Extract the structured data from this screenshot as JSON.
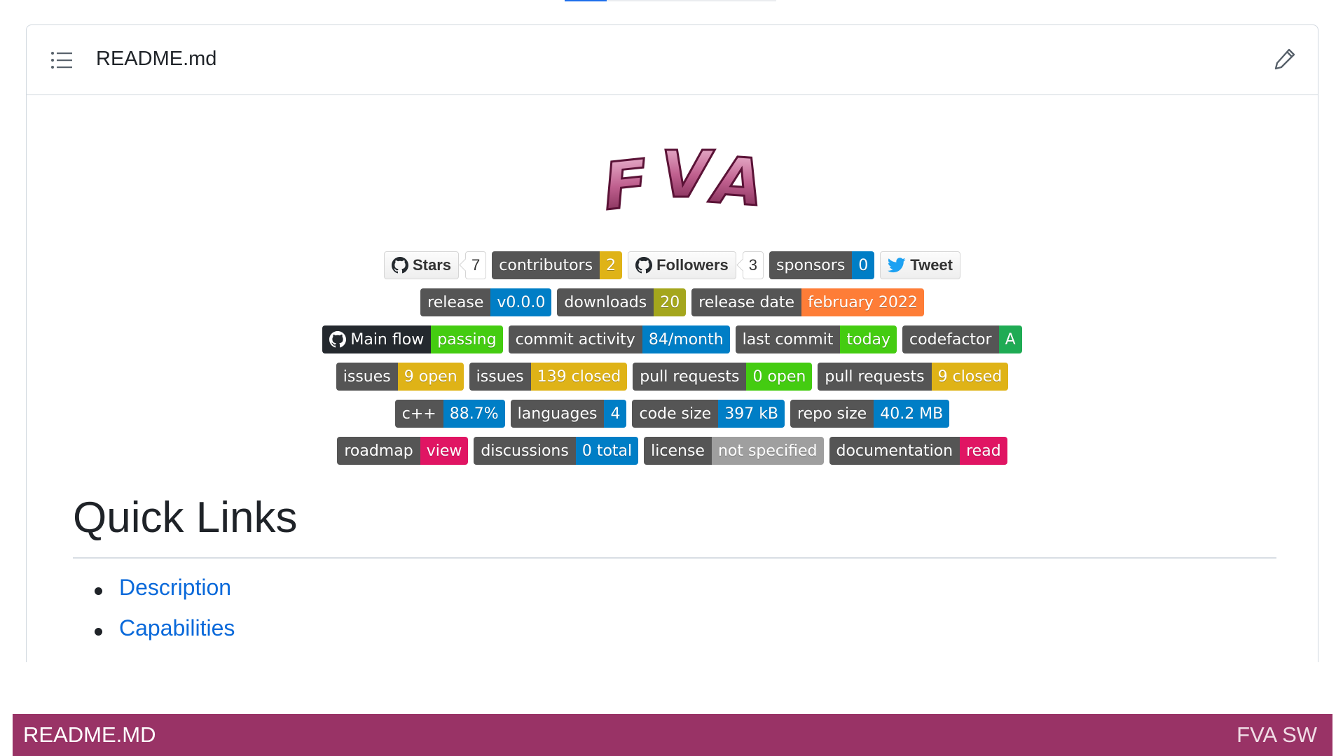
{
  "readme": {
    "title": "README.md"
  },
  "logo": {
    "text": "F V A",
    "letters": [
      "F",
      "V",
      "A"
    ]
  },
  "badge_rows": [
    [
      {
        "kind": "social",
        "icon": "github-icon",
        "label": "Stars",
        "count": "7"
      },
      {
        "kind": "badge",
        "label": "contributors",
        "value": "2",
        "color": "#dfb317"
      },
      {
        "kind": "social",
        "icon": "github-icon",
        "label": "Followers",
        "count": "3"
      },
      {
        "kind": "badge",
        "label": "sponsors",
        "value": "0",
        "color": "#007ec6"
      },
      {
        "kind": "tweet",
        "icon": "twitter-icon",
        "label": "Tweet"
      }
    ],
    [
      {
        "kind": "badge",
        "label": "release",
        "value": "v0.0.0",
        "color": "#007ec6"
      },
      {
        "kind": "badge",
        "label": "downloads",
        "value": "20",
        "color": "#a4a61d"
      },
      {
        "kind": "badge",
        "label": "release date",
        "value": "february 2022",
        "color": "#fe7d37"
      }
    ],
    [
      {
        "kind": "badge",
        "label": "Main flow",
        "value": "passing",
        "color": "#4c1",
        "icon": "github-icon",
        "dark": true
      },
      {
        "kind": "badge",
        "label": "commit activity",
        "value": "84/month",
        "color": "#007ec6"
      },
      {
        "kind": "badge",
        "label": "last commit",
        "value": "today",
        "color": "#4c1"
      },
      {
        "kind": "badge",
        "label": "codefactor",
        "value": "A",
        "color": "#1fab54"
      }
    ],
    [
      {
        "kind": "badge",
        "label": "issues",
        "value": "9 open",
        "color": "#dfb317"
      },
      {
        "kind": "badge",
        "label": "issues",
        "value": "139 closed",
        "color": "#dfb317"
      },
      {
        "kind": "badge",
        "label": "pull requests",
        "value": "0 open",
        "color": "#4c1"
      },
      {
        "kind": "badge",
        "label": "pull requests",
        "value": "9 closed",
        "color": "#dfb317"
      }
    ],
    [
      {
        "kind": "badge",
        "label": "c++",
        "value": "88.7%",
        "color": "#007ec6"
      },
      {
        "kind": "badge",
        "label": "languages",
        "value": "4",
        "color": "#007ec6"
      },
      {
        "kind": "badge",
        "label": "code size",
        "value": "397 kB",
        "color": "#007ec6"
      },
      {
        "kind": "badge",
        "label": "repo size",
        "value": "40.2 MB",
        "color": "#007ec6"
      }
    ],
    [
      {
        "kind": "badge",
        "label": "roadmap",
        "value": "view",
        "color": "#e01563"
      },
      {
        "kind": "badge",
        "label": "discussions",
        "value": "0 total",
        "color": "#007ec6"
      },
      {
        "kind": "badge",
        "label": "license",
        "value": "not specified",
        "color": "#9f9f9f"
      },
      {
        "kind": "badge",
        "label": "documentation",
        "value": "read",
        "color": "#e01563"
      }
    ]
  ],
  "quick_links": {
    "heading": "Quick Links",
    "items": [
      "Description",
      "Capabilities"
    ]
  },
  "footer": {
    "left": "README.MD",
    "right": "FVA SW"
  }
}
